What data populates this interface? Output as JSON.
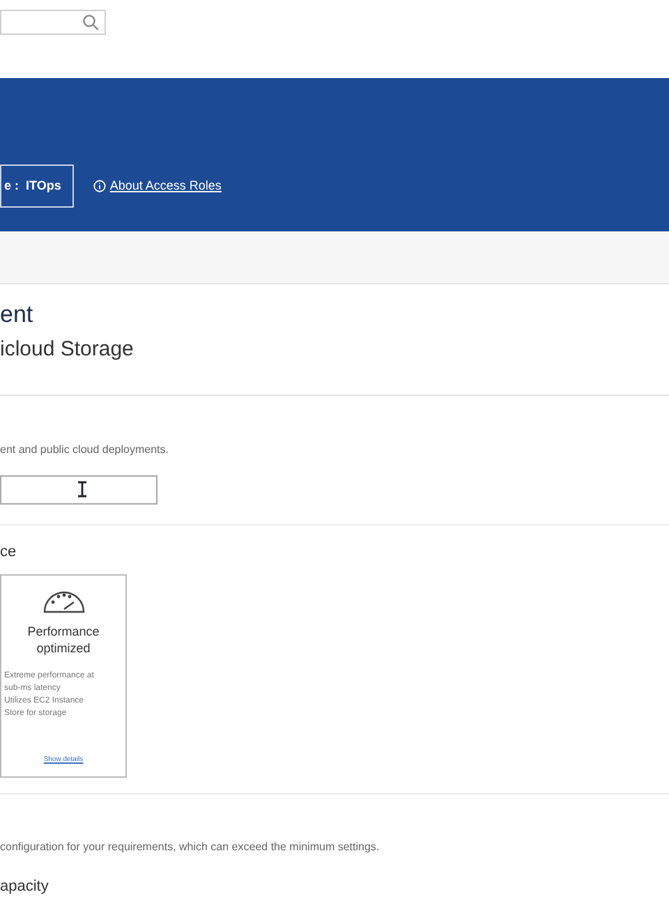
{
  "banner": {
    "role_chip": "e :  ITOps",
    "link": "About Access Roles"
  },
  "section_heading": {
    "title": "ent",
    "subtitle": "icloud Storage"
  },
  "deployment": {
    "description": "ent and public cloud deployments."
  },
  "performance": {
    "label": "ce",
    "cards": [
      {
        "title": "Performance optimized",
        "lines": [
          "Extreme performance at",
          "sub-ms latency",
          "Utilizes EC2 Instance",
          "Store for storage"
        ],
        "link": "Show details"
      }
    ]
  },
  "capacity": {
    "description": "configuration for your requirements, which can exceed the minimum settings.",
    "label": "apacity"
  }
}
